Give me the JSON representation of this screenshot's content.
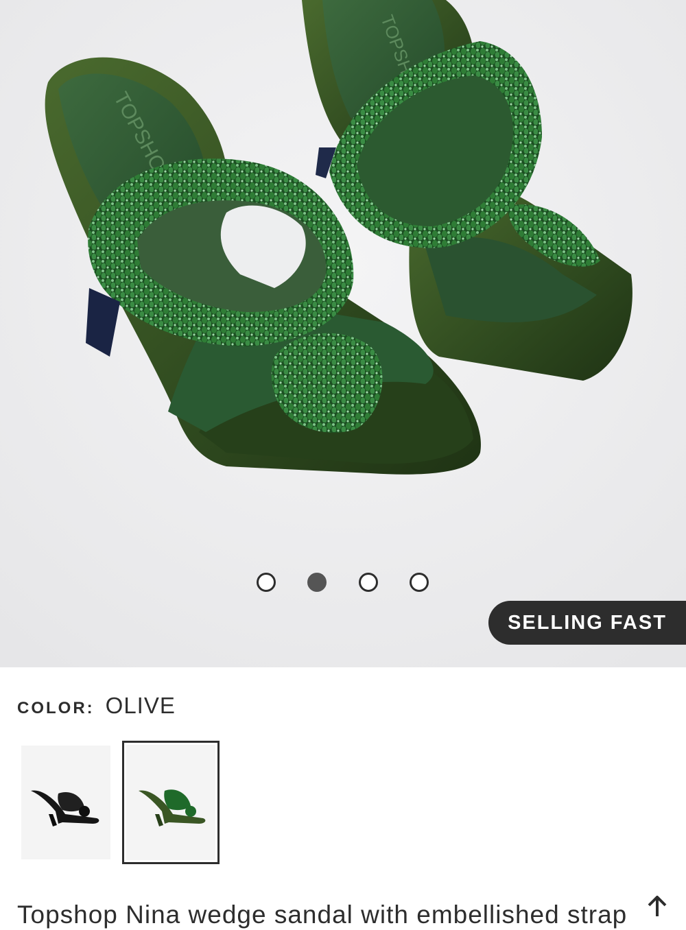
{
  "gallery": {
    "brand_imprint": "TOPSHOP",
    "badge": "SELLING FAST",
    "dots": [
      {
        "active": false
      },
      {
        "active": true
      },
      {
        "active": false
      },
      {
        "active": false
      }
    ]
  },
  "color": {
    "label": "COLOR:",
    "value": "OLIVE"
  },
  "swatches": [
    {
      "color": "black",
      "selected": false
    },
    {
      "color": "olive",
      "selected": true
    }
  ],
  "product": {
    "title_partial": "Topshop Nina wedge sandal with embellished strap"
  },
  "icons": {
    "back_to_top": "arrow-up-icon"
  },
  "colors": {
    "olive_dark": "#2f4a1f",
    "olive": "#3f5a28",
    "bead_green": "#1f6a2a",
    "badge_bg": "#2d2d2d"
  }
}
